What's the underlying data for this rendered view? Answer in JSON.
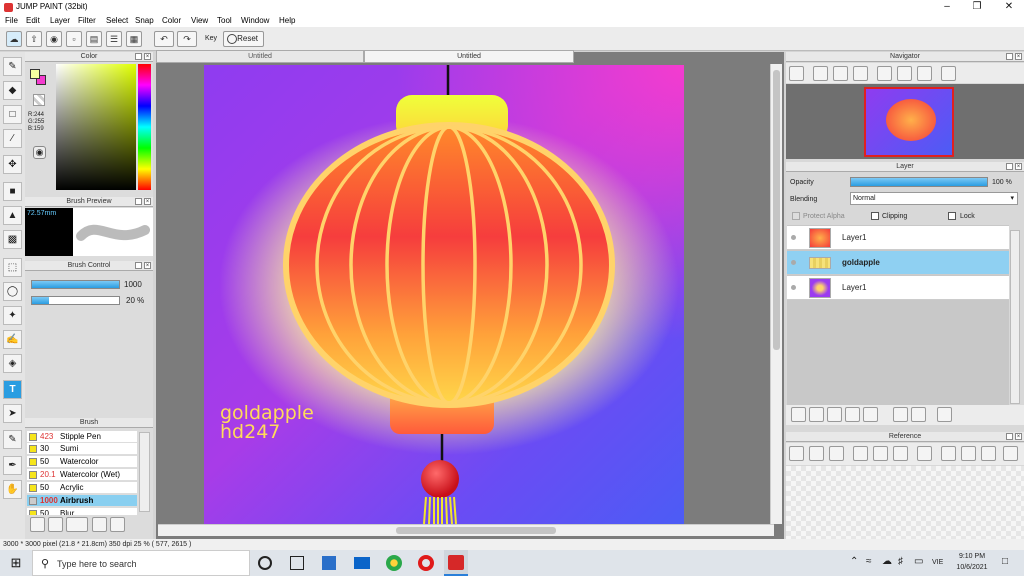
{
  "window": {
    "title": "JUMP PAINT (32bit)"
  },
  "menu": [
    "File",
    "Edit",
    "Layer",
    "Filter",
    "Select",
    "Snap",
    "Color",
    "View",
    "Tool",
    "Window",
    "Help"
  ],
  "toolbar": {
    "key_label": "Key",
    "reset_label": "Reset"
  },
  "tabs": [
    "Untitled",
    "Untitled"
  ],
  "color_panel": {
    "title": "Color",
    "r": "R:244",
    "g": "G:255",
    "b": "B:159"
  },
  "brush_preview": {
    "title": "Brush Preview",
    "size": "72.57mm"
  },
  "brush_control": {
    "title": "Brush Control",
    "size_value": "1000",
    "opacity_value": "20 %",
    "size_fill": 1.0,
    "opacity_fill": 0.2
  },
  "brush_panel": {
    "title": "Brush",
    "items": [
      {
        "num": "423",
        "name": "Stipple Pen"
      },
      {
        "num": "30",
        "name": "Sumi"
      },
      {
        "num": "50",
        "name": "Watercolor"
      },
      {
        "num": "20.1",
        "name": "Watercolor (Wet)"
      },
      {
        "num": "50",
        "name": "Acrylic"
      },
      {
        "num": "1000",
        "name": "Airbrush"
      },
      {
        "num": "50",
        "name": "Blur"
      }
    ]
  },
  "canvas": {
    "text1": "goldapple",
    "text2": "hd247"
  },
  "navigator": {
    "title": "Navigator"
  },
  "layer_panel": {
    "title": "Layer",
    "opacity_label": "Opacity",
    "opacity_value": "100 %",
    "blending_label": "Blending",
    "blending_value": "Normal",
    "protect_alpha": "Protect Alpha",
    "clipping": "Clipping",
    "lock": "Lock",
    "layers": [
      {
        "name": "Layer1"
      },
      {
        "name": "goldapple"
      },
      {
        "name": "Layer1"
      }
    ]
  },
  "reference": {
    "title": "Reference"
  },
  "status": {
    "text": "3000 * 3000 pixel   (21.8 * 21.8cm)   350 dpi   25 %   ( 577, 2615 )"
  },
  "taskbar": {
    "search_placeholder": "Type here to search",
    "time": "9:10 PM",
    "date": "10/6/2021",
    "lang": "VIE"
  },
  "colors": {
    "accent": "#2a9de1",
    "selection": "#89cff0",
    "lantern_red": "#f43a3a",
    "lantern_yellow": "#ffd34a",
    "bg_violet": "#9b3cf0",
    "bg_blue": "#4c5cf5",
    "bg_pink": "#f43ccf"
  }
}
